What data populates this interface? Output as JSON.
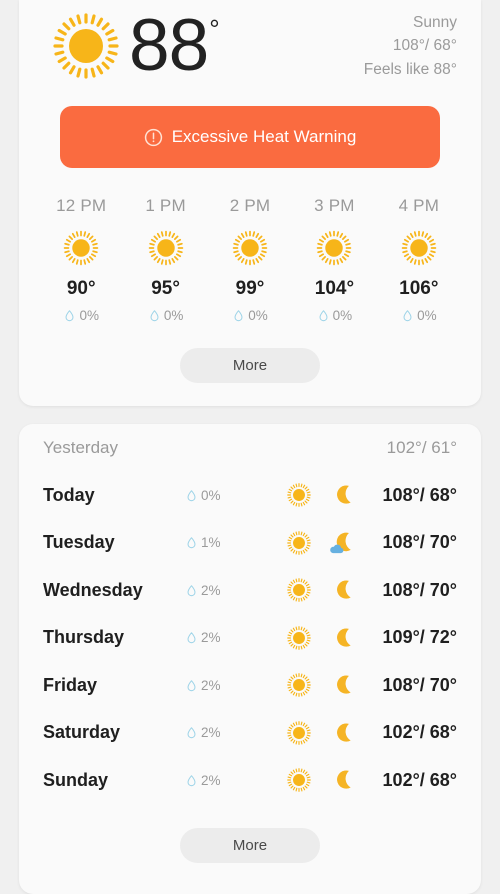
{
  "current": {
    "icon": "sun-icon",
    "temperature": "88",
    "degree_symbol": "°",
    "condition": "Sunny",
    "high_low": "108°/ 68°",
    "feels_like": "Feels like 88°"
  },
  "alert": {
    "icon": "alert-circle-icon",
    "label": "Excessive Heat Warning",
    "background_color": "#fa6b40",
    "text_color": "#ffffff"
  },
  "hourly": {
    "more_label": "More",
    "items": [
      {
        "time": "12 PM",
        "icon": "sun-icon",
        "temp": "90°",
        "precip": "0%"
      },
      {
        "time": "1 PM",
        "icon": "sun-icon",
        "temp": "95°",
        "precip": "0%"
      },
      {
        "time": "2 PM",
        "icon": "sun-icon",
        "temp": "99°",
        "precip": "0%"
      },
      {
        "time": "3 PM",
        "icon": "sun-icon",
        "temp": "104°",
        "precip": "0%"
      },
      {
        "time": "4 PM",
        "icon": "sun-icon",
        "temp": "106°",
        "precip": "0%"
      }
    ]
  },
  "daily": {
    "more_label": "More",
    "yesterday": {
      "label": "Yesterday",
      "temps": "102°/ 61°"
    },
    "rows": [
      {
        "day": "Today",
        "precip": "0%",
        "day_icon": "sun-icon",
        "night_icon": "moon-icon",
        "temps": "108°/ 68°"
      },
      {
        "day": "Tuesday",
        "precip": "1%",
        "day_icon": "sun-icon",
        "night_icon": "moon-cloud-icon",
        "temps": "108°/ 70°"
      },
      {
        "day": "Wednesday",
        "precip": "2%",
        "day_icon": "sun-icon",
        "night_icon": "moon-icon",
        "temps": "108°/ 70°"
      },
      {
        "day": "Thursday",
        "precip": "2%",
        "day_icon": "sun-icon",
        "night_icon": "moon-icon",
        "temps": "109°/ 72°"
      },
      {
        "day": "Friday",
        "precip": "2%",
        "day_icon": "sun-icon",
        "night_icon": "moon-icon",
        "temps": "108°/ 70°"
      },
      {
        "day": "Saturday",
        "precip": "2%",
        "day_icon": "sun-icon",
        "night_icon": "moon-icon",
        "temps": "102°/ 68°"
      },
      {
        "day": "Sunday",
        "precip": "2%",
        "day_icon": "sun-icon",
        "night_icon": "moon-icon",
        "temps": "102°/ 68°"
      }
    ]
  },
  "colors": {
    "sun": "#f7b519",
    "moon": "#f5b425",
    "cloud": "#66b0e0",
    "raindrop": "#9fd4e8",
    "alert": "#fa6b40",
    "page_background": "#f0f0f0",
    "card_background": "#fafafa"
  }
}
